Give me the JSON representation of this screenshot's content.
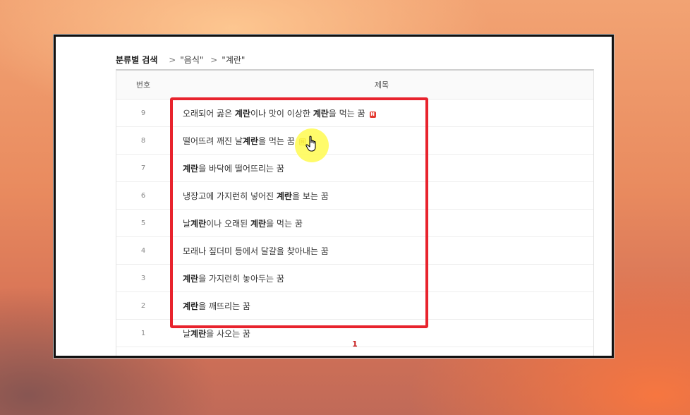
{
  "breadcrumb": {
    "root": "분류별 검색",
    "items": [
      "\"음식\"",
      "\"계란\""
    ],
    "separator": ">"
  },
  "table": {
    "columns": {
      "number": "번호",
      "title": "제목"
    },
    "rows": [
      {
        "number": "9",
        "parts": [
          [
            "오래되어 곯은 ",
            false
          ],
          [
            "계란",
            true
          ],
          [
            "이나 맛이 이상한 ",
            false
          ],
          [
            "계란",
            true
          ],
          [
            "을 먹는 꿈",
            false
          ]
        ],
        "badge": "N",
        "badge_style": "filled"
      },
      {
        "number": "8",
        "parts": [
          [
            "떨어뜨려 깨진 날",
            false
          ],
          [
            "계란",
            true
          ],
          [
            "을 먹는 꿈",
            false
          ]
        ],
        "badge": "N",
        "badge_style": "outline"
      },
      {
        "number": "7",
        "parts": [
          [
            "계란",
            true
          ],
          [
            "을 바닥에 떨어뜨리는 꿈",
            false
          ]
        ]
      },
      {
        "number": "6",
        "parts": [
          [
            "냉장고에 가지런히 넣어진 ",
            false
          ],
          [
            "계란",
            true
          ],
          [
            "을 보는 꿈",
            false
          ]
        ]
      },
      {
        "number": "5",
        "parts": [
          [
            "날",
            false
          ],
          [
            "계란",
            true
          ],
          [
            "이나 오래된 ",
            false
          ],
          [
            "계란",
            true
          ],
          [
            "을 먹는 꿈",
            false
          ]
        ]
      },
      {
        "number": "4",
        "parts": [
          [
            "모래나 짚더미 등에서 달걀을 찾아내는 꿈",
            false
          ]
        ]
      },
      {
        "number": "3",
        "parts": [
          [
            "계란",
            true
          ],
          [
            "을 가지런히 놓아두는 꿈",
            false
          ]
        ]
      },
      {
        "number": "2",
        "parts": [
          [
            "계란",
            true
          ],
          [
            "을 깨뜨리는 꿈",
            false
          ]
        ]
      },
      {
        "number": "1",
        "parts": [
          [
            "날",
            false
          ],
          [
            "계란",
            true
          ],
          [
            "을 사오는 꿈",
            false
          ]
        ]
      }
    ]
  },
  "pagination": {
    "current": "1"
  },
  "colors": {
    "highlight": "#e8232d",
    "page_active": "#c81e1e",
    "cursor_halo": "#fffa50",
    "badge_new": "#e3392f"
  },
  "overlay": {
    "cursor_icon": "hand-pointer-icon"
  }
}
